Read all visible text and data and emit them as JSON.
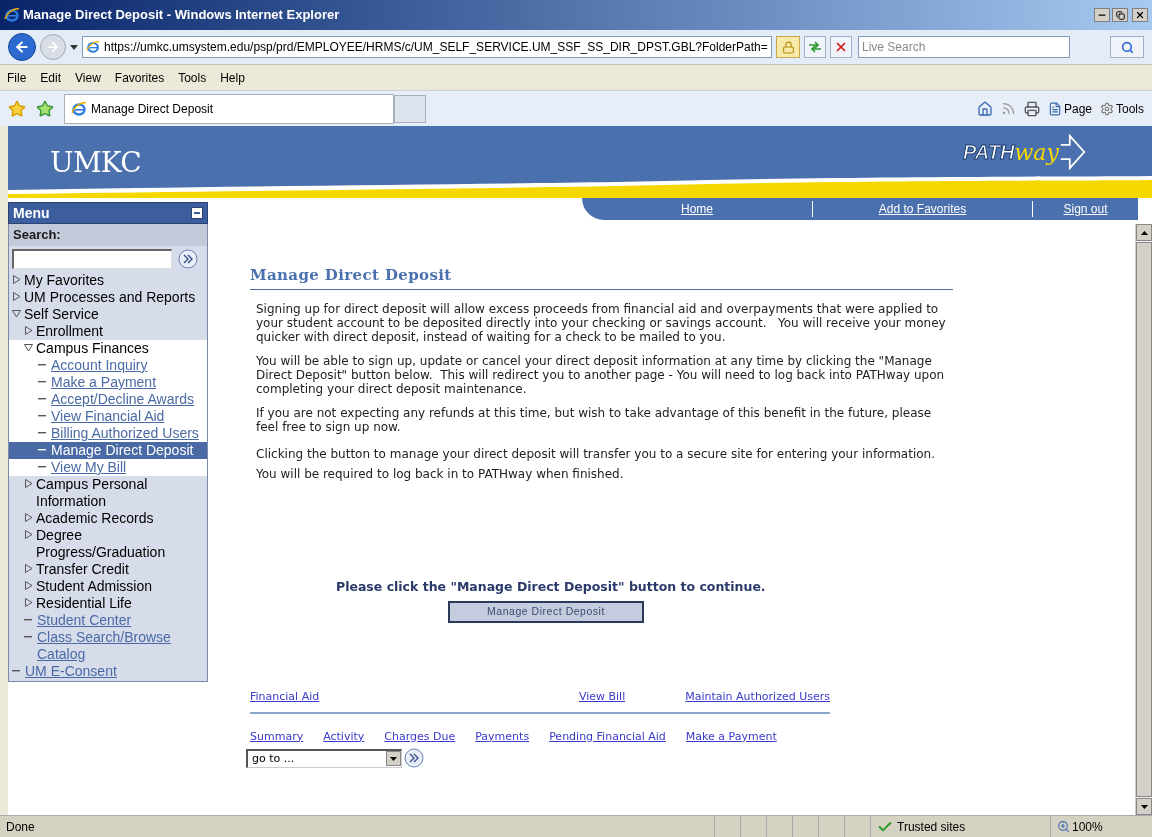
{
  "window": {
    "title": "Manage Direct Deposit - Windows Internet Explorer"
  },
  "address_bar": {
    "url": "https://umkc.umsystem.edu/psp/prd/EMPLOYEE/HRMS/c/UM_SELF_SERVICE.UM_SSF_SS_DIR_DPST.GBL?FolderPath="
  },
  "search": {
    "placeholder": "Live Search"
  },
  "menu_bar": [
    "File",
    "Edit",
    "View",
    "Favorites",
    "Tools",
    "Help"
  ],
  "tabs": [
    {
      "label": "Manage Direct Deposit",
      "selected": true
    }
  ],
  "command_bar": [
    "Page",
    "Tools"
  ],
  "banner": {
    "logo": "UMKC",
    "pathway_logo": [
      "PATH",
      "way"
    ]
  },
  "nav_links": [
    "Home",
    "Add to Favorites",
    "Sign out"
  ],
  "sidebar": {
    "title": "Menu",
    "search_label": "Search:",
    "tree": [
      {
        "label": "My Favorites",
        "kind": "folder",
        "expanded": false
      },
      {
        "label": "UM Processes and Reports",
        "kind": "folder",
        "expanded": false
      },
      {
        "label": "Self Service",
        "kind": "folder",
        "expanded": true,
        "children": [
          {
            "label": "Enrollment",
            "kind": "folder",
            "expanded": false
          },
          {
            "label": "Campus Finances",
            "kind": "folder",
            "expanded": true,
            "children": [
              {
                "label": "Account Inquiry",
                "kind": "link",
                "selected": false
              },
              {
                "label": "Make a Payment",
                "kind": "link",
                "selected": false
              },
              {
                "label": "Accept/Decline Awards",
                "kind": "link",
                "selected": false
              },
              {
                "label": "View Financial Aid",
                "kind": "link",
                "selected": false
              },
              {
                "label": "Billing Authorized Users",
                "kind": "link",
                "selected": false
              },
              {
                "label": "Manage Direct Deposit",
                "kind": "link",
                "selected": true
              },
              {
                "label": "View My Bill",
                "kind": "link",
                "selected": false
              }
            ]
          },
          {
            "label": "Campus Personal Information",
            "kind": "folder",
            "expanded": false
          },
          {
            "label": "Academic Records",
            "kind": "folder",
            "expanded": false
          },
          {
            "label": "Degree Progress/Graduation",
            "kind": "folder",
            "expanded": false
          },
          {
            "label": "Transfer Credit",
            "kind": "folder",
            "expanded": false
          },
          {
            "label": "Student Admission",
            "kind": "folder",
            "expanded": false
          },
          {
            "label": "Residential Life",
            "kind": "folder",
            "expanded": false
          },
          {
            "label": "Student Center",
            "kind": "link",
            "selected": false
          },
          {
            "label": "Class Search/Browse Catalog",
            "kind": "link",
            "selected": false
          }
        ]
      },
      {
        "label": "UM E-Consent",
        "kind": "link",
        "selected": false
      }
    ]
  },
  "content": {
    "heading": "Manage Direct Deposit",
    "paragraphs": [
      "Signing up for direct deposit will allow excess proceeds from financial aid and overpayments that were applied to your student account to be deposited directly into your checking or savings account.   You will receive your money quicker with direct deposit, instead of waiting for a check to be mailed to you.",
      "You will be able to sign up, update or cancel your direct deposit information at any time by clicking the \"Manage Direct Deposit\" button below.  This will redirect you to another page - You will need to log back into PATHway upon completing your direct deposit maintenance.",
      "If you are not expecting any refunds at this time, but wish to take advantage of this benefit in the future, please feel free to sign up now.",
      "Clicking the button to manage your direct deposit will transfer you to a secure site for entering your information.  You will be required to log back in to PATHway when finished."
    ],
    "prompt": "Please click the \"Manage Direct Deposit\" button to continue.",
    "button": "Manage Direct Deposit",
    "links_top": [
      "Financial Aid",
      "View Bill",
      "Maintain Authorized Users"
    ],
    "links_bottom": [
      "Summary",
      "Activity",
      "Charges Due",
      "Payments",
      "Pending Financial Aid",
      "Make a Payment"
    ],
    "goto": {
      "value": "go to ..."
    }
  },
  "status_bar": {
    "text": "Done",
    "zone": "Trusted sites",
    "zoom": "100%"
  }
}
